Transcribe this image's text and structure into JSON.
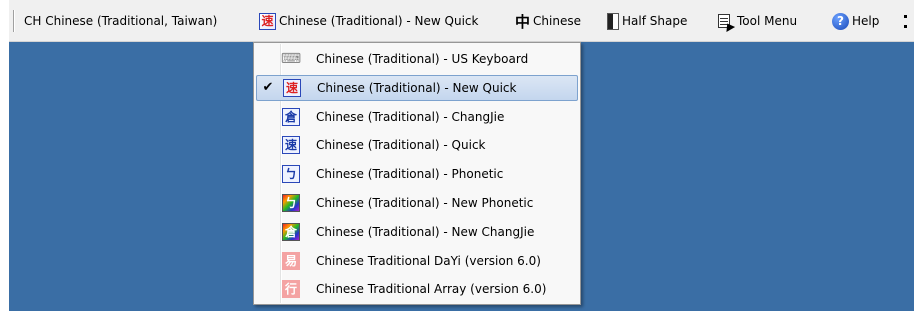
{
  "langbar": {
    "language": "CH Chinese (Traditional, Taiwan)",
    "ime_label": "Chinese (Traditional) - New Quick",
    "ime_icon": "new-quick-ime-icon",
    "ime_icon_glyph": "速",
    "mode_glyph": "中",
    "mode_label": "Chinese",
    "shape_label": "Half Shape",
    "tool_menu_label": "Tool Menu",
    "help_glyph": "?",
    "help_label": "Help"
  },
  "menu": {
    "selected_index": 1,
    "items": [
      {
        "label": "Chinese (Traditional) - US Keyboard",
        "icon": "keyboard-icon",
        "glyph": "⌨",
        "checked": false
      },
      {
        "label": "Chinese (Traditional) - New Quick",
        "icon": "new-quick-icon",
        "glyph": "速",
        "checked": true
      },
      {
        "label": "Chinese (Traditional) - ChangJie",
        "icon": "changjie-icon",
        "glyph": "倉",
        "checked": false
      },
      {
        "label": "Chinese (Traditional) - Quick",
        "icon": "quick-icon",
        "glyph": "速",
        "checked": false
      },
      {
        "label": "Chinese (Traditional) - Phonetic",
        "icon": "phonetic-icon",
        "glyph": "ㄅ",
        "checked": false
      },
      {
        "label": "Chinese (Traditional) - New Phonetic",
        "icon": "new-phonetic-icon",
        "glyph": "ㄅ",
        "checked": false
      },
      {
        "label": "Chinese (Traditional) - New ChangJie",
        "icon": "new-changjie-icon",
        "glyph": "倉",
        "checked": false
      },
      {
        "label": "Chinese Traditional DaYi (version 6.0)",
        "icon": "dayi-icon",
        "glyph": "易",
        "checked": false
      },
      {
        "label": "Chinese Traditional Array (version 6.0)",
        "icon": "array-icon",
        "glyph": "行",
        "checked": false
      }
    ],
    "check_glyph": "✔"
  },
  "colors": {
    "desktop": "#3a6ea5",
    "menu_highlight": "#c4d6ee",
    "menu_highlight_border": "#7da2ce"
  }
}
